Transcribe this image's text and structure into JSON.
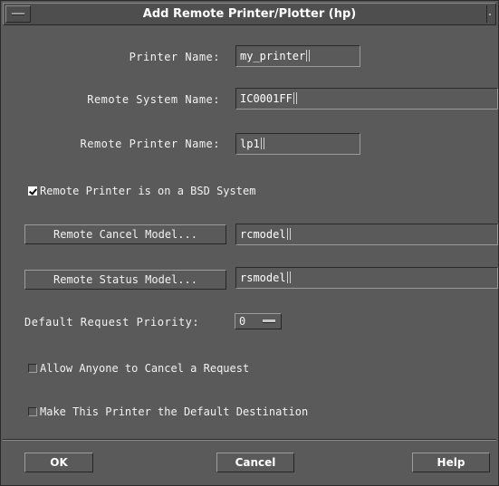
{
  "window": {
    "title": "Add Remote Printer/Plotter (hp)"
  },
  "form": {
    "printer_name": {
      "label": "Printer Name:",
      "value": "my_printer"
    },
    "remote_system_name": {
      "label": "Remote System Name:",
      "value": "IC0001FF"
    },
    "remote_printer_name": {
      "label": "Remote Printer Name:",
      "value": "lp1"
    },
    "bsd_system": {
      "label": "Remote Printer is on a BSD System",
      "checked": true
    },
    "remote_cancel_model": {
      "button_label": "Remote Cancel Model...",
      "value": "rcmodel"
    },
    "remote_status_model": {
      "button_label": "Remote Status Model...",
      "value": "rsmodel"
    },
    "default_priority": {
      "label": "Default Request Priority:",
      "value": "0"
    },
    "allow_anyone_cancel": {
      "label": "Allow Anyone to Cancel a Request",
      "checked": false
    },
    "default_destination": {
      "label": "Make This Printer the Default Destination",
      "checked": false
    }
  },
  "actions": {
    "ok": "OK",
    "cancel": "Cancel",
    "help": "Help"
  },
  "colors": {
    "background": "#5a5a5a",
    "text": "#f2f2f2"
  },
  "icons": {
    "window_menu": "window-menu-icon",
    "checkmark": "checkmark-icon",
    "option_indicator": "option-menu-indicator-icon"
  }
}
